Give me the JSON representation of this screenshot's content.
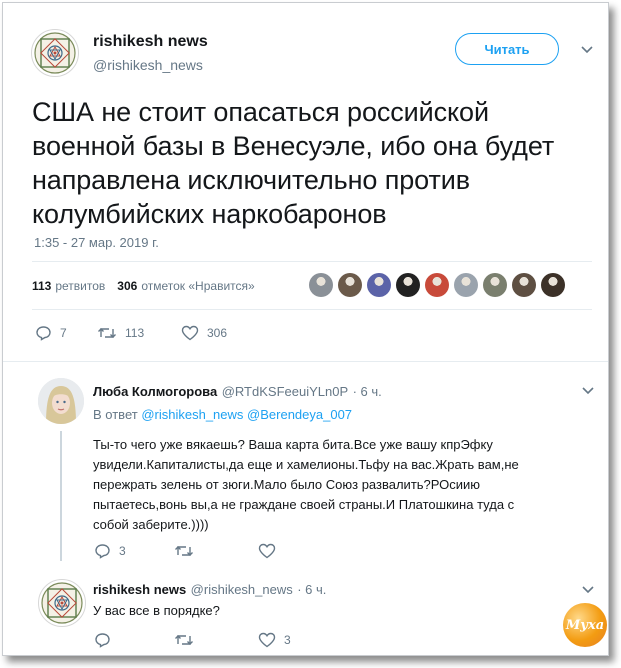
{
  "tweet": {
    "author_name": "rishikesh news",
    "author_handle": "@rishikesh_news",
    "follow_label": "Читать",
    "text": "США не стоит опасаться российской военной базы в Венесуэле, ибо она будет направлена исключительно против колумбийских наркобаронов",
    "timestamp": "1:35 - 27 мар. 2019 г.",
    "retweets_count": "113",
    "retweets_label": "ретвитов",
    "likes_count": "306",
    "likes_label": "отметок «Нравится»",
    "actions": {
      "reply": "7",
      "retweet": "113",
      "like": "306"
    }
  },
  "replies": [
    {
      "author_name": "Люба Колмогорова",
      "author_handle": "@RTdKSFeeuiYLn0P",
      "time": "· 6 ч.",
      "reply_to_prefix": "В ответ",
      "reply_to_1": "@rishikesh_news",
      "reply_to_2": "@Berendeya_007",
      "text": "Ты-то чего уже вякаешь? Ваша карта бита.Все уже вашу кпрЭфку увидели.Капиталисты,да еще и хамелионы.Тьфу на вас.Жрать вам,не пережрать зелень от зюги.Мало было Союз развалить?РОсиию пытаетесь,вонь вы,а не граждане своей страны.И Платошкина туда с собой заберите.))))",
      "actions": {
        "reply": "3",
        "retweet": "",
        "like": ""
      }
    },
    {
      "author_name": "rishikesh news",
      "author_handle": "@rishikesh_news",
      "time": "· 6 ч.",
      "text": "У вас все в порядке?",
      "actions": {
        "reply": "",
        "retweet": "",
        "like": "3"
      }
    }
  ],
  "liker_avatar_colors": [
    "#8a9097",
    "#6b5a4a",
    "#5b63a8",
    "#222222",
    "#c84a3a",
    "#9aa3ad",
    "#7a7f6e",
    "#5e4f42",
    "#3c3128"
  ],
  "watermark_text": "Муха",
  "colors": {
    "accent": "#1da1f2",
    "secondary_text": "#657786",
    "border": "#e6ecf0"
  }
}
